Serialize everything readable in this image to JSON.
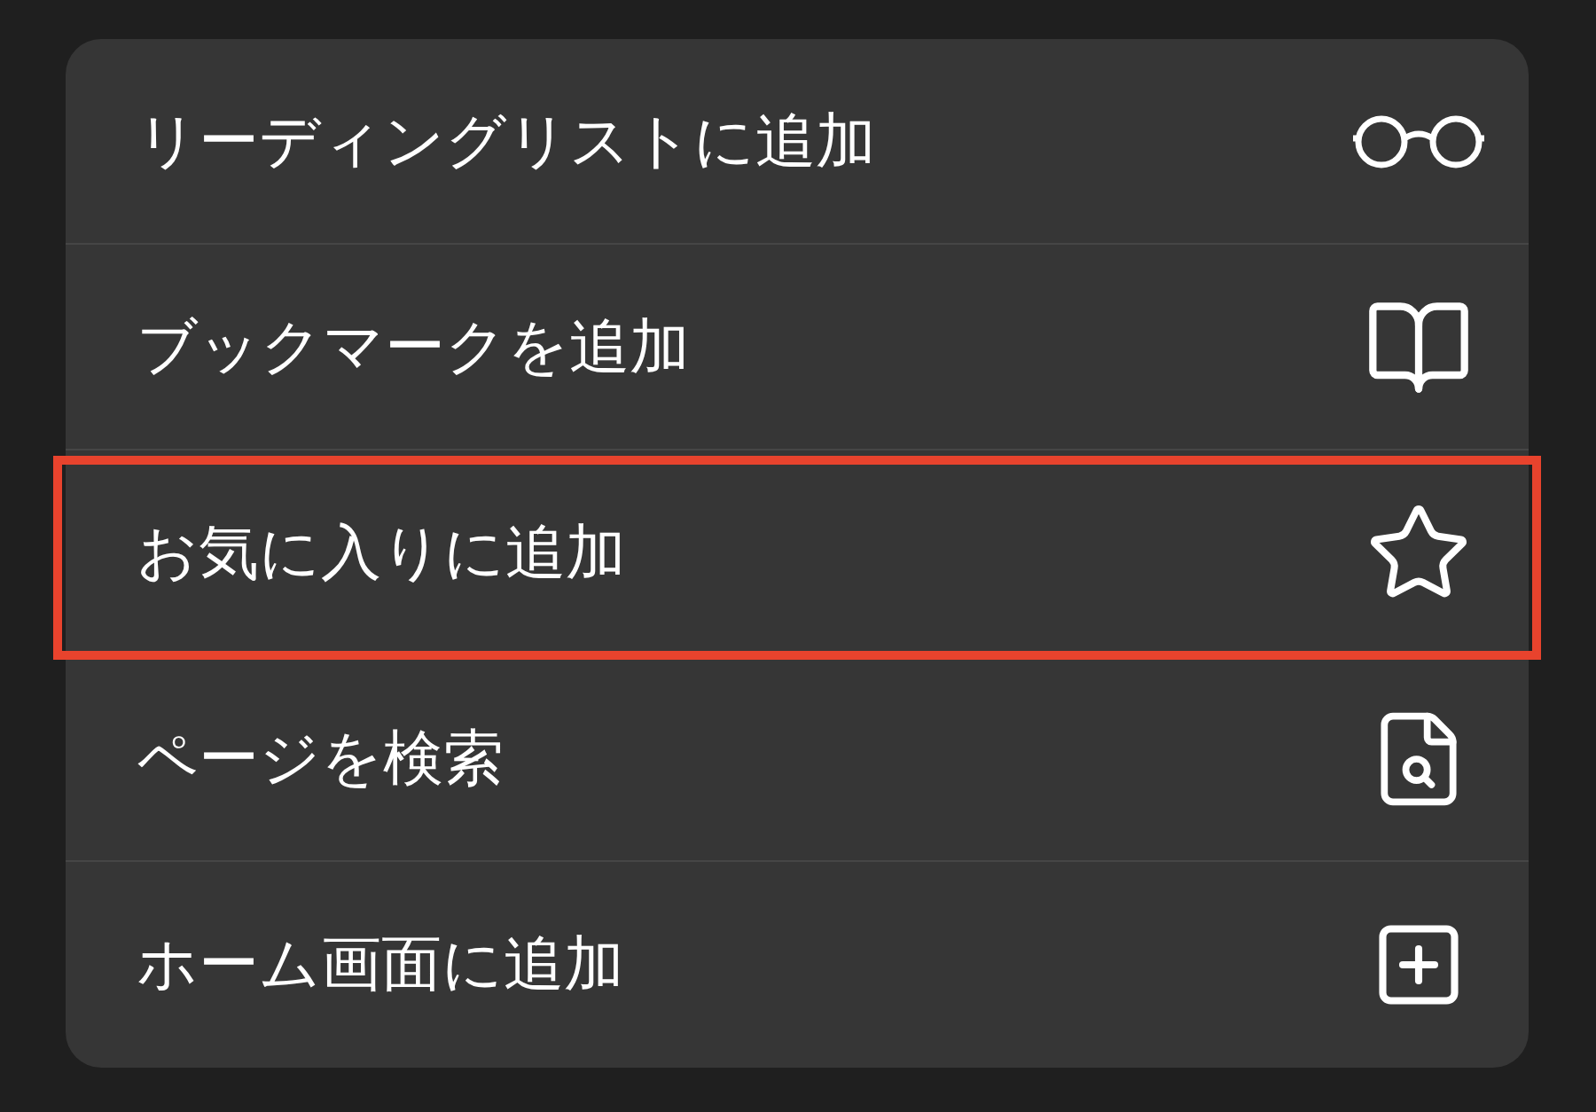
{
  "menu": {
    "items": [
      {
        "label": "リーディングリストに追加",
        "highlighted": false
      },
      {
        "label": "ブックマークを追加",
        "highlighted": false
      },
      {
        "label": "お気に入りに追加",
        "highlighted": true
      },
      {
        "label": "ページを検索",
        "highlighted": false
      },
      {
        "label": "ホーム画面に追加",
        "highlighted": false
      }
    ]
  }
}
